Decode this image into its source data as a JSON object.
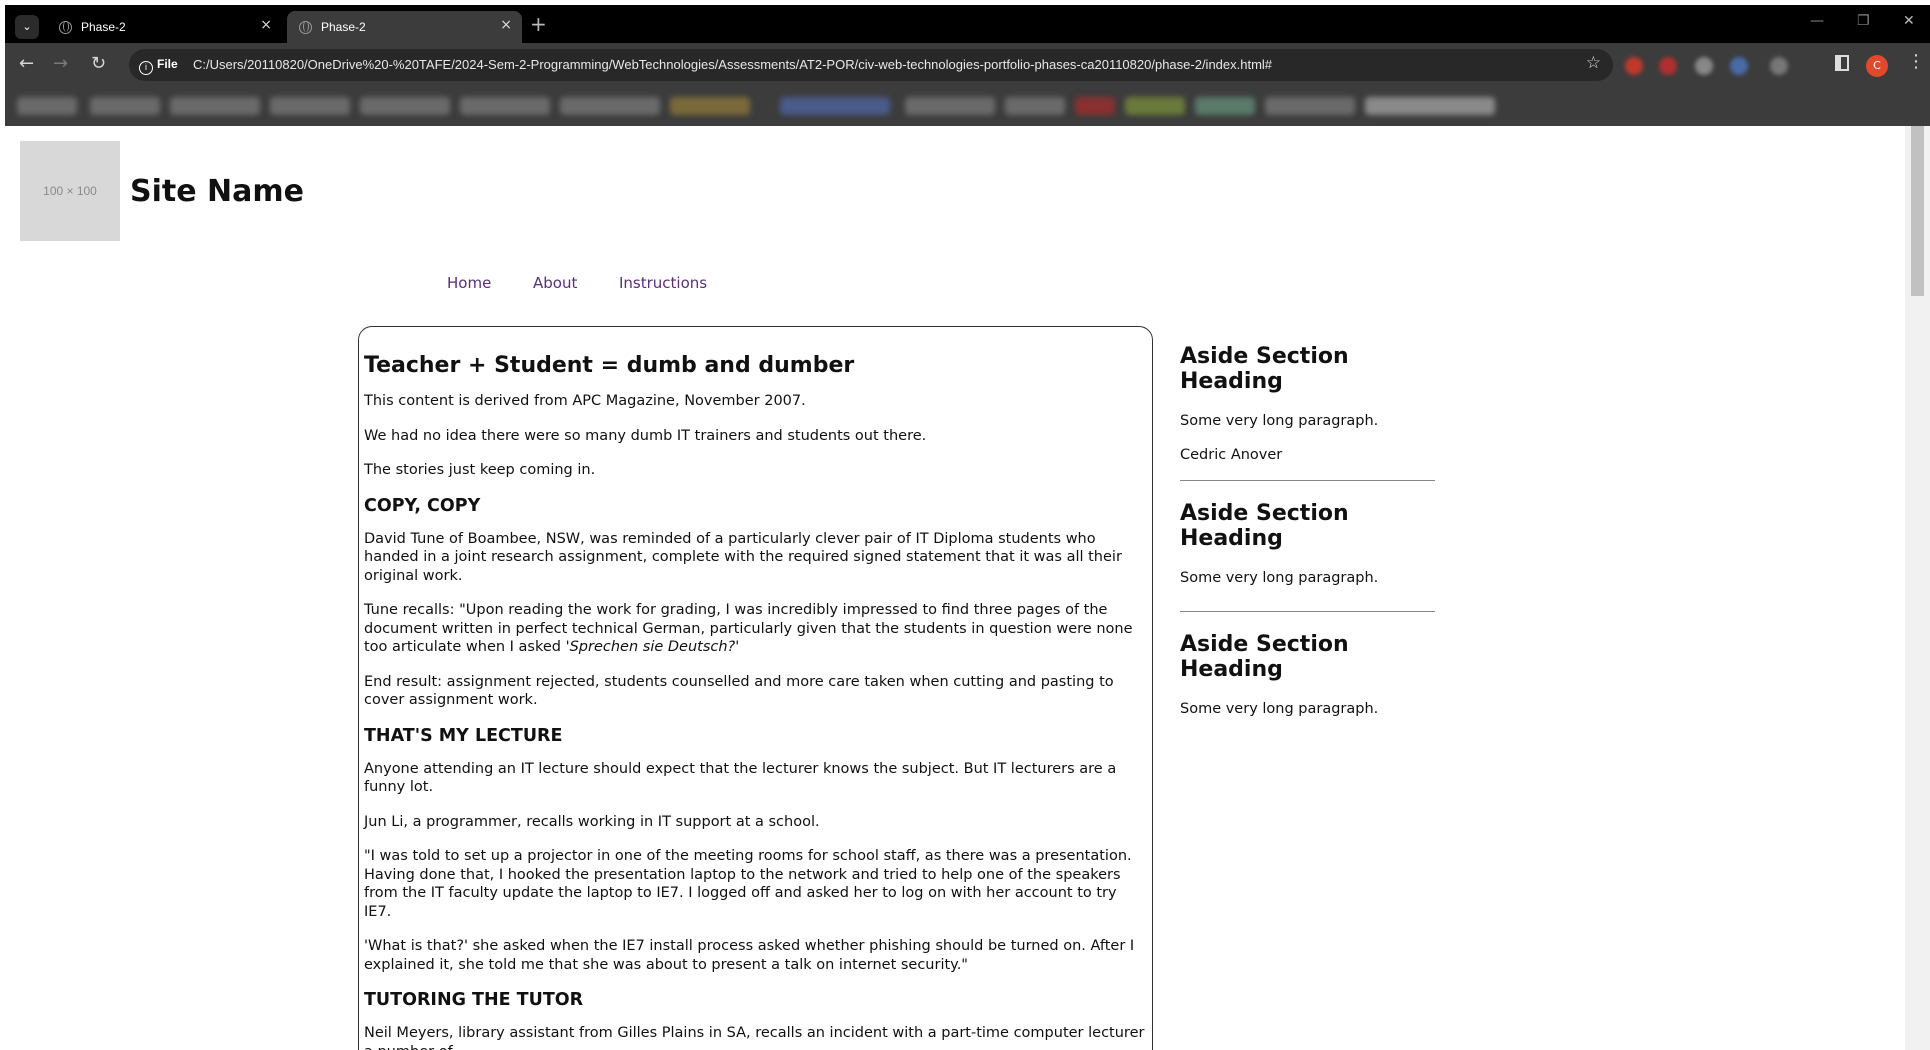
{
  "browser": {
    "tabs": [
      {
        "title": "Phase-2",
        "close": "×"
      },
      {
        "title": "Phase-2",
        "close": "×"
      }
    ],
    "new_tab": "+",
    "window": {
      "minimize": "—",
      "maximize": "❐",
      "close": "✕"
    },
    "nav": {
      "back": "←",
      "forward": "→",
      "reload": "↻"
    },
    "site_info": "File",
    "url": "C:/Users/20110820/OneDrive%20-%20TAFE/2024-Sem-2-Programming/WebTechnologies/Assessments/AT2-POR/civ-web-technologies-portfolio-phases-ca20110820/phase-2/index.html#",
    "bookmark_star": "☆",
    "profile_initial": "C",
    "menu": "⋮"
  },
  "header": {
    "logo_placeholder": "100 × 100",
    "site_name": "Site Name"
  },
  "nav": {
    "home": "Home",
    "about": "About",
    "instructions": "Instructions"
  },
  "article": {
    "title": "Teacher + Student = dumb and dumber",
    "intro": [
      "This content is derived from APC Magazine, November 2007.",
      "We had no idea there were so many dumb IT trainers and students out there.",
      "The stories just keep coming in."
    ],
    "section1": {
      "heading": "COPY, COPY",
      "p1": "David Tune of Boambee, NSW, was reminded of a particularly clever pair of IT Diploma students who handed in a joint research assignment, complete with the required signed statement that it was all their original work.",
      "p2_start": "Tune recalls: \"Upon reading the work for grading, I was incredibly impressed to find three pages of the document written in perfect technical German, particularly given that the students in question were none too articulate when I asked ",
      "p2_em": "'Sprechen sie Deutsch?'",
      "p3": "End result: assignment rejected, students counselled and more care taken when cutting and pasting to cover assignment work."
    },
    "section2": {
      "heading": "THAT'S MY LECTURE",
      "p1": "Anyone attending an IT lecture should expect that the lecturer knows the subject. But IT lecturers are a funny lot.",
      "p2": "Jun Li, a programmer, recalls working in IT support at a school.",
      "p3": "\"I was told to set up a projector in one of the meeting rooms for school staff, as there was a presentation. Having done that, I hooked the presentation laptop to the network and tried to help one of the speakers from the IT faculty update the laptop to IE7. I logged off and asked her to log on with her account to try IE7.",
      "p4": "'What is that?' she asked when the IE7 install process asked whether phishing should be turned on. After I explained it, she told me that she was about to present a talk on internet security.\""
    },
    "section3": {
      "heading": "TUTORING THE TUTOR",
      "p1": "Neil Meyers, library assistant from Gilles Plains in SA, recalls an incident with a part-time computer lecturer a number of"
    }
  },
  "aside": {
    "sections": [
      {
        "heading": "Aside Section Heading",
        "text": "Some very long paragraph.",
        "author": "Cedric Anover"
      },
      {
        "heading": "Aside Section Heading",
        "text": "Some very long paragraph."
      },
      {
        "heading": "Aside Section Heading",
        "text": "Some very long paragraph."
      }
    ]
  }
}
